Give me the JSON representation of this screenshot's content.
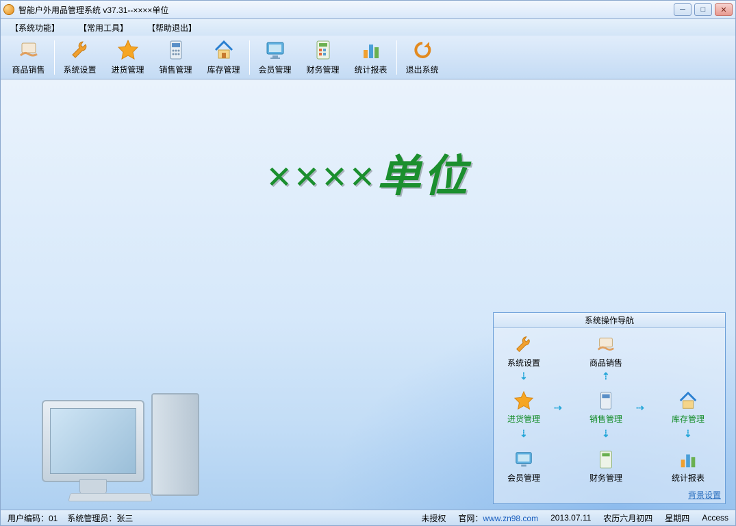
{
  "window": {
    "title": "智能户外用品管理系统 v37.31--××××单位"
  },
  "menu": {
    "items": [
      "【系统功能】",
      "【常用工具】",
      "【帮助退出】"
    ]
  },
  "toolbar": {
    "items": [
      {
        "label": "商品销售",
        "icon": "hand-card-icon"
      },
      {
        "label": "系统设置",
        "icon": "wrench-icon"
      },
      {
        "label": "进货管理",
        "icon": "star-icon"
      },
      {
        "label": "销售管理",
        "icon": "calculator-icon"
      },
      {
        "label": "库存管理",
        "icon": "house-icon"
      },
      {
        "label": "会员管理",
        "icon": "monitor-icon"
      },
      {
        "label": "财务管理",
        "icon": "calc2-icon"
      },
      {
        "label": "统计报表",
        "icon": "chart-icon"
      },
      {
        "label": "退出系统",
        "icon": "refresh-icon"
      }
    ]
  },
  "main": {
    "title": "××××单位"
  },
  "nav_panel": {
    "title": "系统操作导航",
    "items": {
      "system_settings": "系统设置",
      "product_sales": "商品销售",
      "purchase_mgmt": "进货管理",
      "sales_mgmt": "销售管理",
      "stock_mgmt": "库存管理",
      "member_mgmt": "会员管理",
      "finance_mgmt": "财务管理",
      "stats_report": "统计报表"
    },
    "bg_setting": "背景设置"
  },
  "statusbar": {
    "user_code_label": "用户编码：01",
    "admin_label": "系统管理员：张三",
    "auth": "未授权",
    "site_label": "官网：",
    "site_url": "www.zn98.com",
    "date": "2013.07.11",
    "lunar": "农历六月初四",
    "weekday": "星期四",
    "db": "Access"
  }
}
